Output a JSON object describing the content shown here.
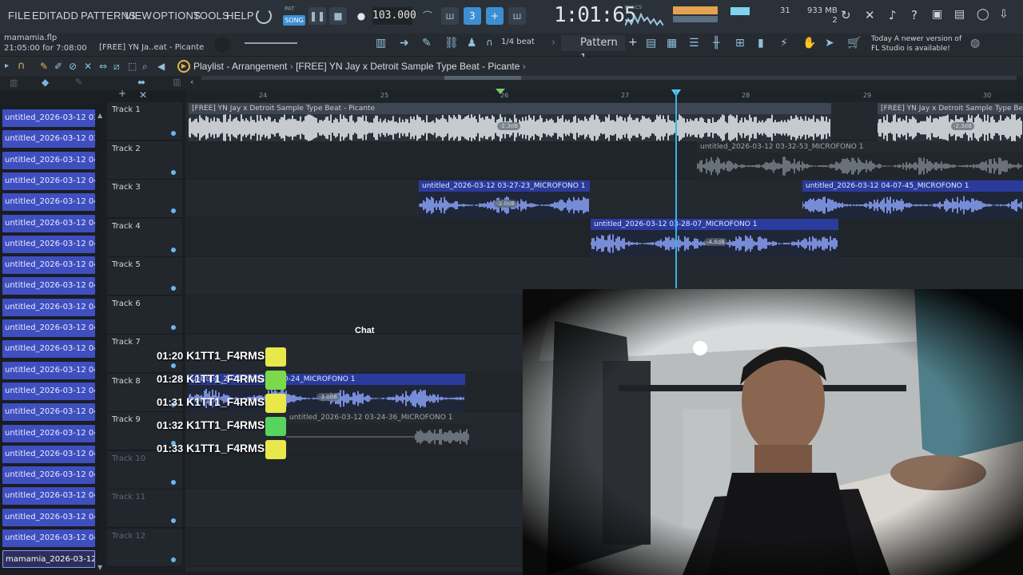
{
  "menu": [
    "FILE",
    "EDIT",
    "ADD",
    "PATTERNS",
    "VIEW",
    "OPTIONS",
    "TOOLS",
    "HELP"
  ],
  "transport": {
    "pat_label": "PAT",
    "song_label": "SONG",
    "tempo": "103.000",
    "time": "1:01:65",
    "time_unit": "M:S:CS",
    "cpu": "31",
    "memory": "933 MB",
    "voices": "2"
  },
  "project": {
    "file": "mamamia.flp",
    "time_info": "21:05:00 for 7:08:00",
    "hint": "[FREE] YN Ja..eat - Picante",
    "snap": "1/4 beat",
    "pattern": "Pattern 1",
    "news_line1": "Today  A newer version of",
    "news_line2": "FL Studio is available!"
  },
  "playlist": {
    "title": "Playlist - Arrangement",
    "breadcrumb": "[FREE] YN Jay x Detroit Sample Type Beat - Picante"
  },
  "ruler": [
    "24",
    "25",
    "26",
    "27",
    "28",
    "29",
    "30"
  ],
  "browser_items": [
    "untitled_2026-03-12 03-...",
    "untitled_2026-03-12 03-...",
    "untitled_2026-03-12 04-...",
    "untitled_2026-03-12 04-...",
    "untitled_2026-03-12 04-...",
    "untitled_2026-03-12 04-...",
    "untitled_2026-03-12 04-...",
    "untitled_2026-03-12 04-...",
    "untitled_2026-03-12 04-...",
    "untitled_2026-03-12 04-...",
    "untitled_2026-03-12 04-...",
    "untitled_2026-03-12 04-...",
    "untitled_2026-03-12 04-...",
    "untitled_2026-03-12 04-...",
    "untitled_2026-03-12 04-...",
    "untitled_2026-03-12 04-...",
    "untitled_2026-03-12 04-...",
    "untitled_2026-03-12 04-...",
    "untitled_2026-03-12 04-...",
    "untitled_2026-03-12 04-...",
    "untitled_2026-03-12 04-...",
    "mamamia_2026-03-12 0..."
  ],
  "tracks": [
    "Track 1",
    "Track 2",
    "Track 3",
    "Track 4",
    "Track 5",
    "Track 6",
    "Track 7",
    "Track 8",
    "Track 9",
    "Track 10",
    "Track 11",
    "Track 12"
  ],
  "clips": {
    "sample1": "[FREE] YN Jay x Detroit Sample Type Beat - Picante",
    "sample1_db": "-2.3dB",
    "sample2": "[FREE] YN Jay x Detroit Sample Type Beat - Picante",
    "sample2_db": "-2.3dB",
    "t2": "untitled_2026-03-12 03-32-53_MICROFONO 1",
    "t3a": "untitled_2026-03-12 03-27-23_MICROFONO 1",
    "t3a_db": "-3.0dB",
    "t3b": "untitled_2026-03-12 04-07-45_MICROFONO 1",
    "t4": "untitled_2026-03-12 03-28-07_MICROFONO 1",
    "t4_db": "-4.6dB",
    "t8": "untitled_2026-03-12 03-20-24_MICROFONO 1",
    "t8_db": "-3.0dB",
    "t9": "untitled_2026-03-12 03-24-36_MICROFONO 1"
  },
  "chat": {
    "title": "Chat",
    "messages": [
      {
        "time": "01:20",
        "user": "K1TT1_F4RMS:"
      },
      {
        "time": "01:28",
        "user": "K1TT1_F4RMS:"
      },
      {
        "time": "01:31",
        "user": "K1TT1_F4RMS:"
      },
      {
        "time": "01:32",
        "user": "K1TT1_F4RMS:"
      },
      {
        "time": "01:33",
        "user": "K1TT1_F4RMS:"
      }
    ]
  },
  "colors": {
    "accent": "#3d8fd1",
    "clip_blue": "#2a3b9c",
    "playhead": "#35b4e8",
    "browser_item": "#3f4fbf"
  }
}
